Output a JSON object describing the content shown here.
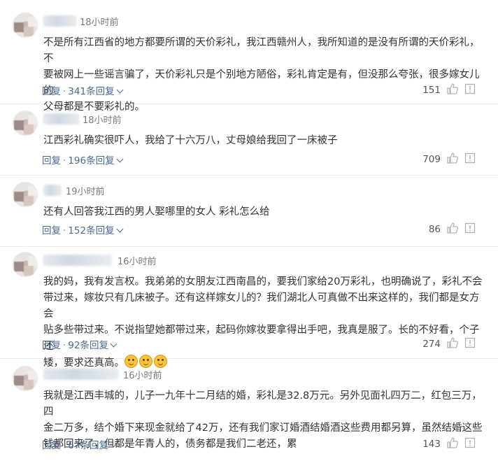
{
  "comments": [
    {
      "time": "18小时前",
      "content": "不是所有江西省的地方都要所谓的天价彩礼，我江西赣州人，我所知道的是没有所谓的天价彩礼，不\n要被网上一些谣言骗了，天价彩礼只是个别地方陋俗，彩礼肯定是有，但没那么夸张，很多嫁女儿的\n父母都是不要彩礼的。",
      "reply_label": "回复",
      "replies_label": "341条回复",
      "likes": "151"
    },
    {
      "time": "18小时前",
      "content": "江西彩礼确实很吓人，我给了十六万八，丈母娘给我回了一床被子",
      "reply_label": "回复",
      "replies_label": "196条回复",
      "likes": "709"
    },
    {
      "time": "19小时前",
      "content": "还有人回答我江西的男人娶哪里的女人 彩礼怎么给",
      "reply_label": "回复",
      "replies_label": "152条回复",
      "likes": "86"
    },
    {
      "time": "16小时前",
      "content": "我的妈，我有发言权。我弟弟的女朋友江西南昌的，要我们家给20万彩礼，也明确说了，彩礼不会\n带过来，嫁妆只有几床被子。还有这样嫁女儿的？我们湖北人可真做不出来这样的，我们都是女方会\n贴多些带过来。不说指望她都带过来，起码你嫁妆要拿得出手吧，我真是服了。长的不好看，个子还\n矮，要求还真高。",
      "reply_label": "回复",
      "replies_label": "92条回复",
      "likes": "274"
    },
    {
      "time": "16小时前",
      "content": "我就是江西丰城的，儿子一九年十二月结的婚，彩礼是32.8万元。另外见面礼四万二，红包三万，四\n金二万多，结个婚下来现金就给了42万，还有我们家订婚酒结婚酒这些费用都另算，虽然结婚这些\n钱都回来了，但都是年青人的，债务都是我们二老还，累",
      "reply_label": "回复",
      "replies_label": "67条回复",
      "likes": "143"
    }
  ],
  "colors": {
    "link": "#4a6a8f",
    "meta": "#7a7a7a",
    "text": "#333333",
    "icon": "#b3b3b3"
  },
  "icons": {
    "like": "thumbs-up-icon",
    "report": "report-icon",
    "expand": "chevron-down-icon",
    "emoji": "thinking-face-emoji"
  }
}
